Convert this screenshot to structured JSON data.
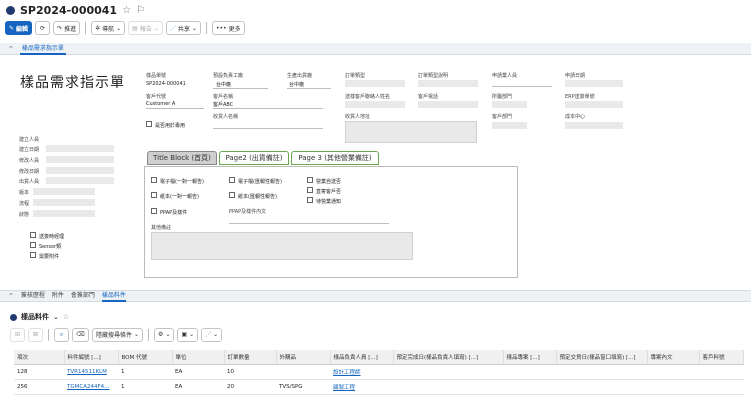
{
  "header": {
    "title": "SP2024-000041"
  },
  "toolbar": {
    "edit": "編輯",
    "push": "推進",
    "navigate": "導航",
    "report": "報告",
    "share": "共享",
    "more": "更多"
  },
  "section": {
    "tab": "樣品需求指示單"
  },
  "form": {
    "title": "樣品需求指示單",
    "fields": {
      "sample_no_label": "樣品單號",
      "sample_no_value": "SP2024-000041",
      "factory_label": "預設負責工廠",
      "factory_value": "台中廠",
      "ship_factory_label": "生產出貨廠",
      "ship_factory_value": "台中廠",
      "order_type_label": "訂單類型",
      "order_type_desc_label": "訂單類型說明",
      "applicant_label": "申請業人員",
      "apply_date_label": "申請日期",
      "customer_code_label": "客戶代號",
      "customer_code_value": "Customer A",
      "customer_name_label": "客戶名稱",
      "customer_name_value": "客戶ABC",
      "contact_label": "送樣客戶聯絡人姓名",
      "phone_label": "客戶電話",
      "dept_label": "所屬部門",
      "erp_label": "ERP送簽單號",
      "recipient_label": "收貨人名稱",
      "address_label": "收貨人地址",
      "dept2_label": "客戶部門",
      "cost_center_label": "成本中心",
      "special_label": "是否用於專用",
      "created_by_label": "建立人員",
      "created_date_label": "建立日期",
      "modified_by_label": "修改人員",
      "modified_date_label": "修改日期",
      "outbound_label": "出貨人員",
      "version_label": "版本",
      "flow_label": "流程",
      "status_label": "狀態",
      "hide_label": "送簽時經理",
      "sensor_label": "Sensor類",
      "attach_label": "需要附件"
    }
  },
  "subtabs": {
    "tab1": "Title Block (首頁)",
    "tab2": "Page2 (出貨備註)",
    "tab3": "Page 3 (其他營業備註)"
  },
  "panel": {
    "cb1": "電子檔(一對一報告)",
    "cb2": "電子檔(匯報性報告)",
    "cb3": "營業自送否",
    "cb4": "紙本(一對一報告)",
    "cb5": "紙本(匯報性報告)",
    "cb6": "直寄客戶否",
    "cb7": "PPAP及樣件",
    "cb8": "待營業通知",
    "ppap_label": "PPAP及樣件內文",
    "other_label": "其他備註"
  },
  "bottom_tabs": [
    "簽核歷程",
    "附件",
    "會簽部門",
    "樣品料件"
  ],
  "list": {
    "title": "樣品料件",
    "filter_btn": "隱藏搜尋條件"
  },
  "table": {
    "columns": [
      "項次",
      "料件編號 [...]",
      "BOM 代號",
      "單位",
      "訂單數量",
      "外購品",
      "樣品負責人員 [...]",
      "預定完成日(樣品負責人填寫) [...]",
      "樣品專案 [...]",
      "預定交貨日(樣品窗口填寫) [...]",
      "專案內文",
      "客戶料號"
    ],
    "rows": [
      [
        "128",
        "TVR14511KLM",
        "1",
        "EA",
        "10",
        "",
        "設計工程師",
        "",
        "",
        "",
        "",
        ""
      ],
      [
        "256",
        "TGMCA244F4...",
        "1",
        "EA",
        "20",
        "TVS/SPG",
        "顧製工程",
        "",
        "",
        "",
        "",
        ""
      ]
    ]
  }
}
